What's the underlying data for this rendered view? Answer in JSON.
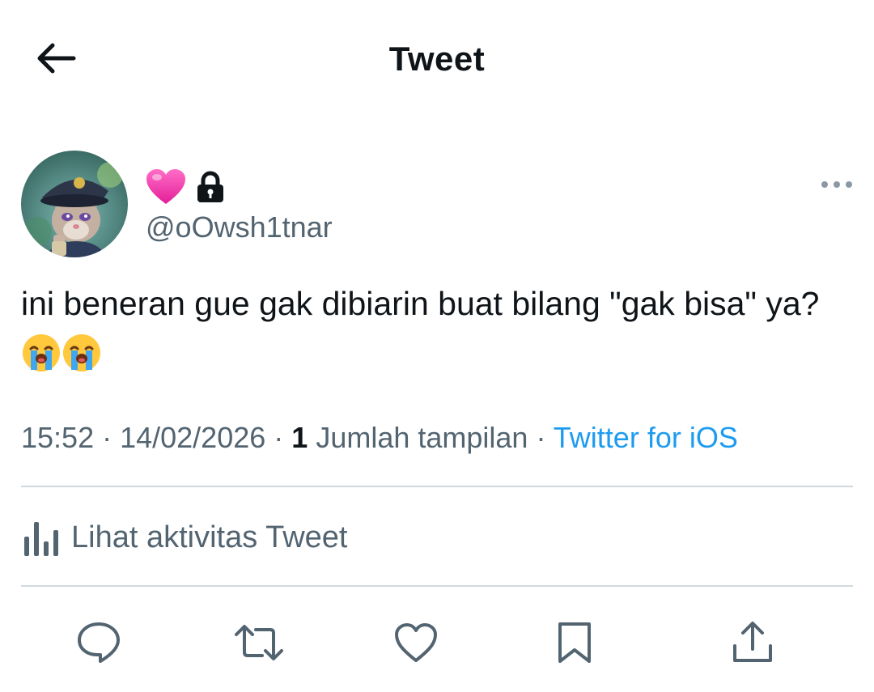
{
  "header": {
    "title": "Tweet"
  },
  "author": {
    "handle": "@oOwsh1tnar",
    "name_icons": [
      "pink-heart-emoji",
      "lock-icon"
    ]
  },
  "tweet": {
    "text_line": "ini beneran gue gak dibiarin buat bilang \"gak bisa\" ya?",
    "emojis": [
      "loudly-crying-face",
      "loudly-crying-face"
    ]
  },
  "meta": {
    "time": "15:52",
    "separator": " · ",
    "date": "14/02/2026",
    "views_count": "1",
    "views_label": " Jumlah tampilan",
    "source": "Twitter for iOS"
  },
  "activity": {
    "label": "Lihat aktivitas Tweet"
  },
  "actions": {
    "icons": [
      "reply-icon",
      "retweet-icon",
      "like-icon",
      "bookmark-icon",
      "share-icon"
    ]
  },
  "colors": {
    "text_primary": "#0f1419",
    "text_secondary": "#536471",
    "link": "#1d9bf0",
    "divider": "#cfd9de"
  }
}
